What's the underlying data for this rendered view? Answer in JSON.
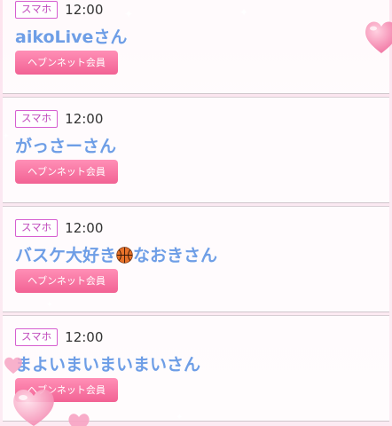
{
  "users": [
    {
      "device": "スマホ",
      "time": "12:00",
      "name": "aikoLiveさん",
      "member_label": "ヘブンネット会員"
    },
    {
      "device": "スマホ",
      "time": "12:00",
      "name": "がっさーさん",
      "member_label": "ヘブンネット会員"
    },
    {
      "device": "スマホ",
      "time": "12:00",
      "name_before": "バスケ大好き",
      "name_icon": "basketball-icon",
      "name_after": "なおきさん",
      "member_label": "ヘブンネット会員"
    },
    {
      "device": "スマホ",
      "time": "12:00",
      "name": "まよいまいまいまいさん",
      "member_label": "ヘブンネット会員"
    }
  ],
  "colors": {
    "name": "#6e9ee6",
    "badge_border": "#d65fd0",
    "button": "#f26294",
    "background": "#fde3ee"
  }
}
